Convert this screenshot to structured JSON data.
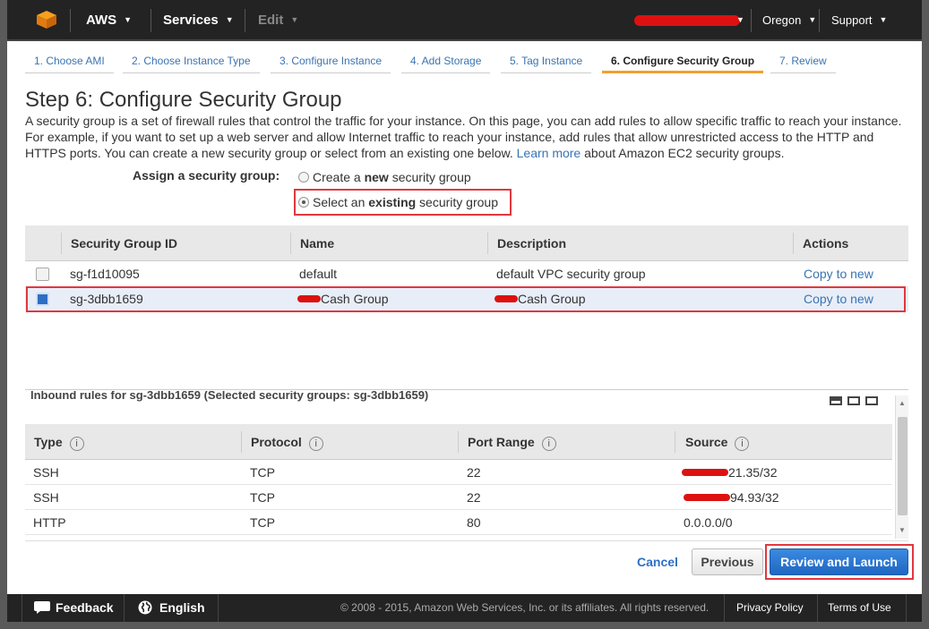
{
  "nav": {
    "aws_label": "AWS",
    "services_label": "Services",
    "edit_label": "Edit",
    "region_label": "Oregon",
    "support_label": "Support"
  },
  "wizard": {
    "steps": [
      {
        "label": "1. Choose AMI"
      },
      {
        "label": "2. Choose Instance Type"
      },
      {
        "label": "3. Configure Instance"
      },
      {
        "label": "4. Add Storage"
      },
      {
        "label": "5. Tag Instance"
      },
      {
        "label": "6. Configure Security Group"
      },
      {
        "label": "7. Review"
      }
    ],
    "active_index": 5
  },
  "page": {
    "title": "Step 6: Configure Security Group",
    "desc_part1": "A security group is a set of firewall rules that control the traffic for your instance. On this page, you can add rules to allow specific traffic to reach your instance. For example, if you want to set up a web server and allow Internet traffic to reach your instance, add rules that allow unrestricted access to the HTTP and HTTPS ports. You can create a new security group or select from an existing one below. ",
    "learn_more": "Learn more",
    "desc_part2": " about Amazon EC2 security groups."
  },
  "assign": {
    "label": "Assign a security group:",
    "opt_create_pre": "Create a ",
    "opt_create_bold": "new",
    "opt_create_post": " security group",
    "opt_select_pre": "Select an ",
    "opt_select_bold": "existing",
    "opt_select_post": " security group",
    "selected": "existing"
  },
  "sg_table": {
    "headers": [
      "Security Group ID",
      "Name",
      "Description",
      "Actions"
    ],
    "rows": [
      {
        "id": "sg-f1d10095",
        "name": "default",
        "description": "default VPC security group",
        "action": "Copy to new",
        "checked": false
      },
      {
        "id": "sg-3dbb1659",
        "name": "Cash Group",
        "description": "Cash Group",
        "action": "Copy to new",
        "checked": true
      }
    ]
  },
  "inbound": {
    "title": "Inbound rules for sg-3dbb1659 (Selected security groups: sg-3dbb1659)",
    "headers": [
      "Type",
      "Protocol",
      "Port Range",
      "Source"
    ],
    "rows": [
      {
        "type": "SSH",
        "protocol": "TCP",
        "port": "22",
        "source": "21.35/32"
      },
      {
        "type": "SSH",
        "protocol": "TCP",
        "port": "22",
        "source": "94.93/32"
      },
      {
        "type": "HTTP",
        "protocol": "TCP",
        "port": "80",
        "source": "0.0.0.0/0"
      }
    ]
  },
  "actions": {
    "cancel": "Cancel",
    "previous": "Previous",
    "launch": "Review and Launch"
  },
  "footer": {
    "feedback": "Feedback",
    "language": "English",
    "copyright": "© 2008 - 2015, Amazon Web Services, Inc. or its affiliates. All rights reserved.",
    "privacy": "Privacy Policy",
    "terms": "Terms of Use"
  },
  "colors": {
    "accent": "#2d6fc4",
    "highlight_red": "#e0383e",
    "active_tab": "#f0a030"
  }
}
